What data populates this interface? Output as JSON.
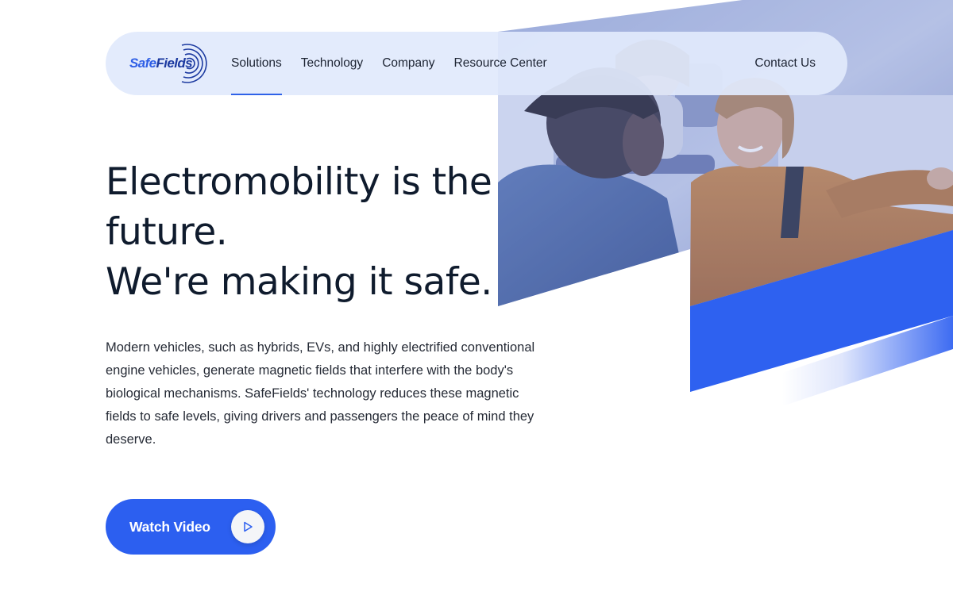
{
  "brand": {
    "logo_prefix": "Safe",
    "logo_suffix": "Fields",
    "primary_color": "#2c5ff0",
    "navy_color": "#1c3aa0"
  },
  "nav": {
    "links": [
      {
        "label": "Solutions",
        "active": true
      },
      {
        "label": "Technology",
        "active": false
      },
      {
        "label": "Company",
        "active": false
      },
      {
        "label": "Resource Center",
        "active": false
      }
    ],
    "contact": "Contact Us"
  },
  "hero": {
    "headline_line1": "Electromobility is the",
    "headline_line2": "future.",
    "headline_line3": "We're making it safe.",
    "description": "Modern vehicles, such as hybrids, EVs, and highly electrified conventional engine vehicles, generate magnetic fields that interfere with the body's biological mechanisms. SafeFields' technology reduces these magnetic fields to safe levels, giving drivers and passengers the peace of mind they deserve.",
    "cta_label": "Watch Video",
    "cta_icon": "play-icon",
    "image_subject": "people-in-car-photo"
  }
}
